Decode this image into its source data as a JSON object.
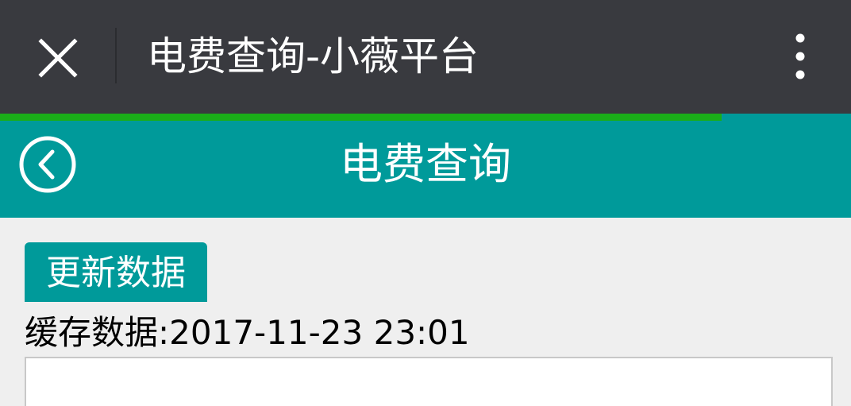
{
  "window": {
    "title": "电费查询-小薇平台",
    "close_icon": "close-icon",
    "more_icon": "more-vertical-icon"
  },
  "progress": {
    "value": 0.848,
    "color": "#1aad19"
  },
  "header": {
    "title": "电费查询",
    "back_icon": "back-circle-icon",
    "color": "#009a9a"
  },
  "main": {
    "refresh_label": "更新数据",
    "cache_label": "缓存数据:",
    "cache_time": "2017-11-23 23:01"
  }
}
